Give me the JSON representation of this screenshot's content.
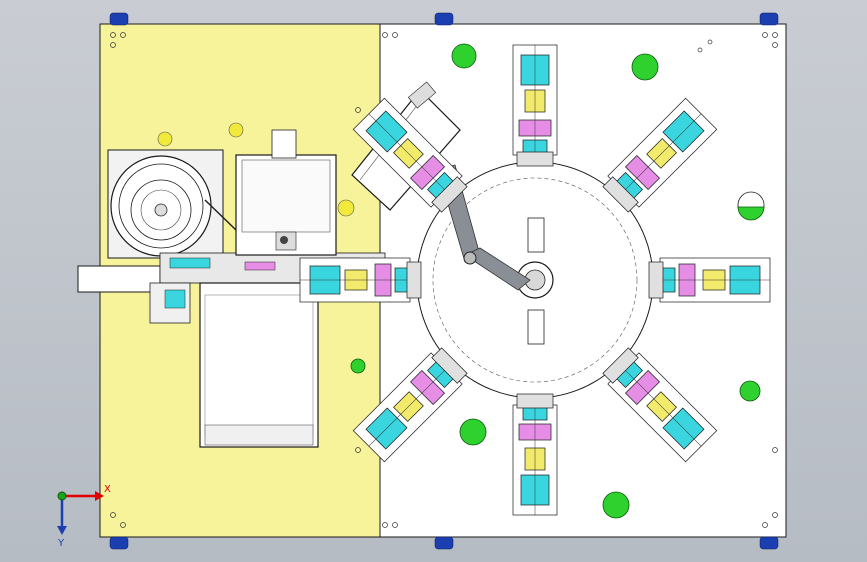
{
  "triad": {
    "x_label": "X",
    "y_label": "Y"
  },
  "colors": {
    "background_top": "#c9cdd3",
    "plate_yellow": "#f6f39b",
    "plate_white": "#ffffff",
    "outline": "#1a1a1a",
    "foot_blue": "#1b3fb0",
    "hole_green": "#2fd12f",
    "accent_cyan": "#3ad6e0",
    "accent_magenta": "#e68ee6",
    "accent_yellow": "#f2ea6a",
    "link_gray": "#8a8f96",
    "axis_red": "#e00000",
    "axis_green": "#19a519",
    "axis_blue": "#1b3fb0"
  },
  "stations": {
    "count": 8
  }
}
